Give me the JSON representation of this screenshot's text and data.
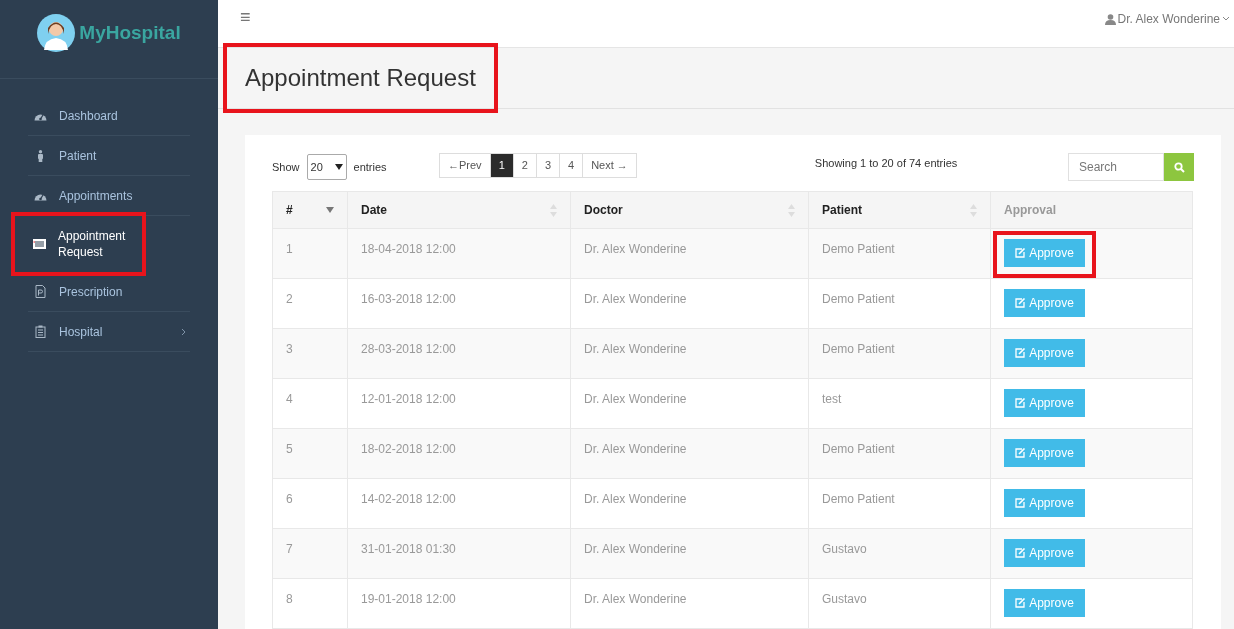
{
  "brand": {
    "name": "MyHospital"
  },
  "sidebar": {
    "items": [
      {
        "label": "Dashboard",
        "selected": false,
        "highlighted": false,
        "has_submenu": false
      },
      {
        "label": "Patient",
        "selected": false,
        "highlighted": false,
        "has_submenu": false
      },
      {
        "label": "Appointments",
        "selected": false,
        "highlighted": false,
        "has_submenu": false
      },
      {
        "label": "Appointment Request",
        "selected": true,
        "highlighted": true,
        "has_submenu": false
      },
      {
        "label": "Prescription",
        "selected": false,
        "highlighted": false,
        "has_submenu": false
      },
      {
        "label": "Hospital",
        "selected": false,
        "highlighted": false,
        "has_submenu": true
      }
    ]
  },
  "topbar": {
    "menu_glyph": "≡",
    "user": "Dr. Alex Wonderine"
  },
  "page_title": {
    "text": "Appointment Request",
    "highlighted": true
  },
  "table_controls": {
    "show_label": "Show",
    "page_size": "20",
    "entries_label": "entries",
    "pages": [
      {
        "label": "←Prev",
        "selected": false
      },
      {
        "label": "1",
        "selected": true
      },
      {
        "label": "2",
        "selected": false
      },
      {
        "label": "3",
        "selected": false
      },
      {
        "label": "4",
        "selected": false
      },
      {
        "label": "Next →",
        "selected": false
      }
    ],
    "info": "Showing 1 to 20 of 74 entries",
    "search": {
      "placeholder": "Search"
    }
  },
  "table": {
    "columns": [
      {
        "label": "#"
      },
      {
        "label": "Date"
      },
      {
        "label": "Doctor"
      },
      {
        "label": "Patient"
      },
      {
        "label": "Approval"
      }
    ],
    "rows": [
      {
        "num": "1",
        "date": "18-04-2018 12:00",
        "doctor": "Dr. Alex Wonderine",
        "patient": "Demo Patient",
        "action": "Approve",
        "highlighted": true
      },
      {
        "num": "2",
        "date": "16-03-2018 12:00",
        "doctor": "Dr. Alex Wonderine",
        "patient": "Demo Patient",
        "action": "Approve",
        "highlighted": false
      },
      {
        "num": "3",
        "date": "28-03-2018 12:00",
        "doctor": "Dr. Alex Wonderine",
        "patient": "Demo Patient",
        "action": "Approve",
        "highlighted": false
      },
      {
        "num": "4",
        "date": "12-01-2018 12:00",
        "doctor": "Dr. Alex Wonderine",
        "patient": "test",
        "action": "Approve",
        "highlighted": false
      },
      {
        "num": "5",
        "date": "18-02-2018 12:00",
        "doctor": "Dr. Alex Wonderine",
        "patient": "Demo Patient",
        "action": "Approve",
        "highlighted": false
      },
      {
        "num": "6",
        "date": "14-02-2018 12:00",
        "doctor": "Dr. Alex Wonderine",
        "patient": "Demo Patient",
        "action": "Approve",
        "highlighted": false
      },
      {
        "num": "7",
        "date": "31-01-2018 01:30",
        "doctor": "Dr. Alex Wonderine",
        "patient": "Gustavo",
        "action": "Approve",
        "highlighted": false
      },
      {
        "num": "8",
        "date": "19-01-2018 12:00",
        "doctor": "Dr. Alex Wonderine",
        "patient": "Gustavo",
        "action": "Approve",
        "highlighted": false
      }
    ]
  }
}
